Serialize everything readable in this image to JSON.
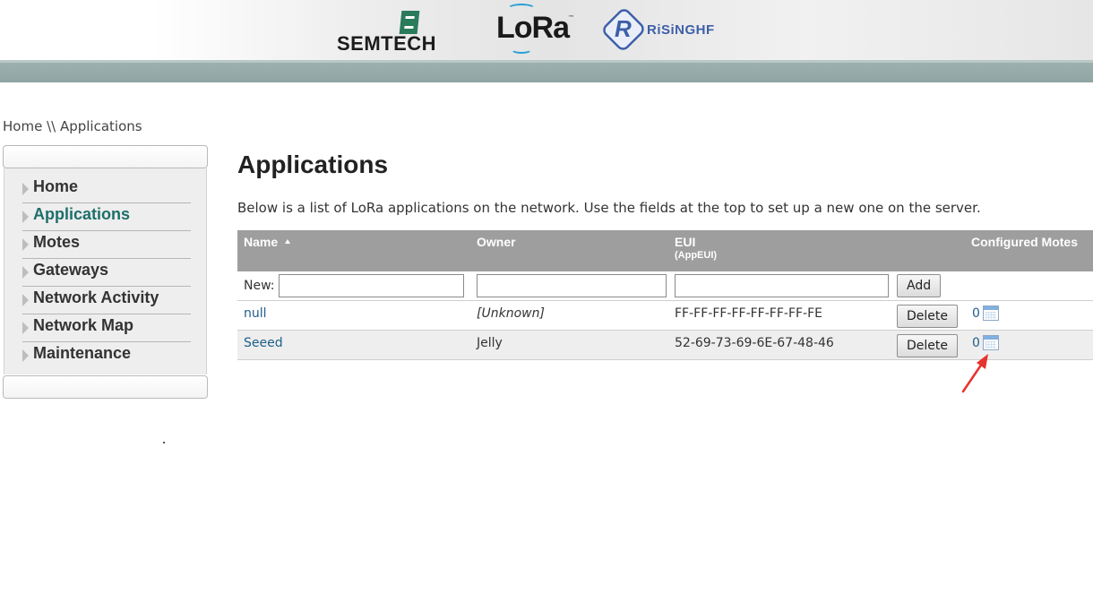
{
  "header": {
    "logos": [
      {
        "name": "semtech-logo",
        "text": "SEMTECH"
      },
      {
        "name": "lora-logo",
        "text": "LoRa",
        "tm": "™"
      },
      {
        "name": "risinghf-logo",
        "text": "RiSiNGHF"
      }
    ],
    "colors": {
      "band": "#9fb2b1",
      "semtech_green": "#2a7a5c",
      "lora_wave": "#2aa0d8",
      "risinghf_blue": "#3d5fa8"
    }
  },
  "breadcrumb": {
    "text": "Home \\\\ Applications"
  },
  "sidebar": {
    "items": [
      {
        "label": "Home",
        "active": false
      },
      {
        "label": "Applications",
        "active": true
      },
      {
        "label": "Motes",
        "active": false
      },
      {
        "label": "Gateways",
        "active": false
      },
      {
        "label": "Network Activity",
        "active": false
      },
      {
        "label": "Network Map",
        "active": false
      },
      {
        "label": "Maintenance",
        "active": false
      }
    ],
    "active_color": "#1e6f6a"
  },
  "main": {
    "title": "Applications",
    "intro": "Below is a list of LoRa applications on the network. Use the fields at the top to set up a new one on the server.",
    "table": {
      "columns": [
        {
          "label": "Name",
          "sort": "ascending"
        },
        {
          "label": "Owner"
        },
        {
          "label": "EUI",
          "sub": "(AppEUI)"
        },
        {
          "label": ""
        },
        {
          "label": "Configured Motes"
        }
      ],
      "new_row": {
        "label": "New:",
        "name_value": "",
        "owner_value": "",
        "eui_value": "",
        "add_label": "Add"
      },
      "rows": [
        {
          "name": "null",
          "owner": "[Unknown]",
          "eui": "FF-FF-FF-FF-FF-FF-FF-FE",
          "delete_label": "Delete",
          "motes": "0"
        },
        {
          "name": "Seeed",
          "owner": "Jelly",
          "eui": "52-69-73-69-6E-67-48-46",
          "delete_label": "Delete",
          "motes": "0"
        }
      ],
      "header_bg": "#9e9e9e",
      "link_color": "#1e5f8a"
    }
  },
  "annotation": {
    "icon": "red-arrow-icon",
    "color": "#e8322e"
  }
}
